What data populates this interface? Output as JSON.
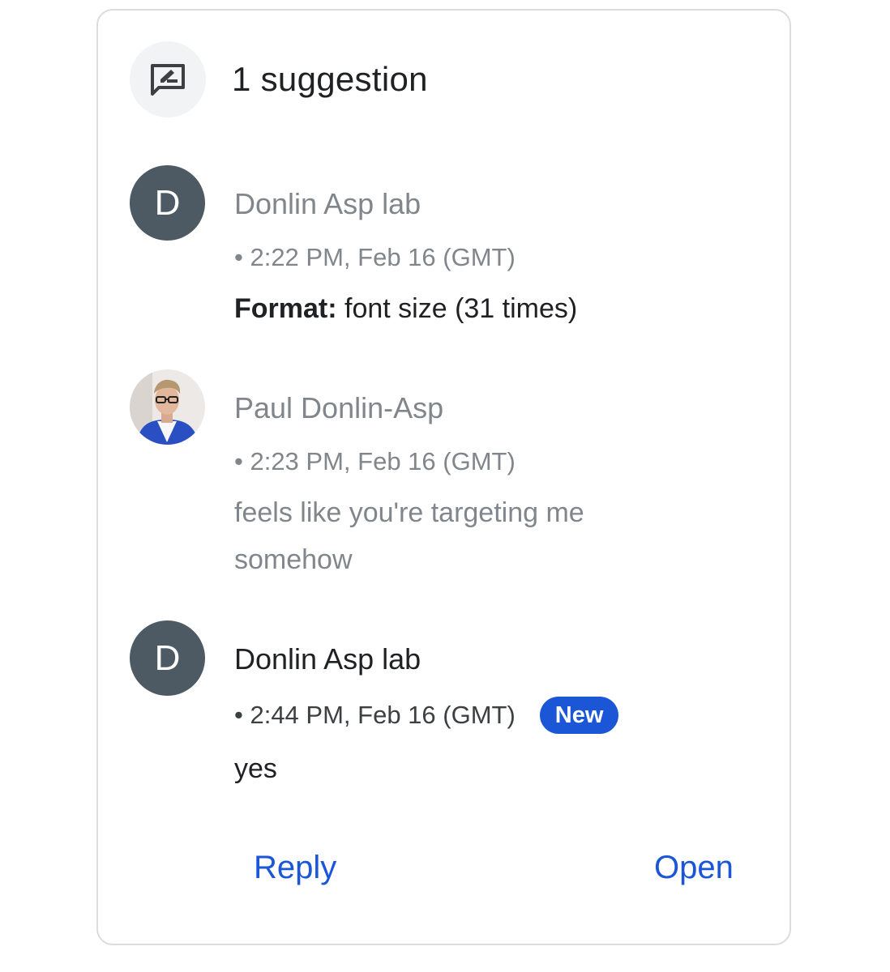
{
  "header": {
    "icon": "suggestion-edit-icon",
    "title": "1 suggestion"
  },
  "entries": [
    {
      "author": "Donlin Asp lab",
      "avatar_letter": "D",
      "timestamp": "• 2:22 PM, Feb 16 (GMT)",
      "label": "Format:",
      "text": " font size (31 times)"
    },
    {
      "author": "Paul Donlin-Asp",
      "avatar": "profile-photo",
      "timestamp": "• 2:23 PM, Feb 16 (GMT)",
      "text": "feels like you're targeting me somehow"
    },
    {
      "author": "Donlin Asp lab",
      "avatar_letter": "D",
      "timestamp": "• 2:44 PM, Feb 16 (GMT)",
      "badge": "New",
      "text": "yes"
    }
  ],
  "actions": {
    "reply_label": "Reply",
    "open_label": "Open"
  },
  "colors": {
    "accent": "#1a56d6",
    "avatar_bg": "#4d5a63",
    "muted_text": "#80868b"
  }
}
